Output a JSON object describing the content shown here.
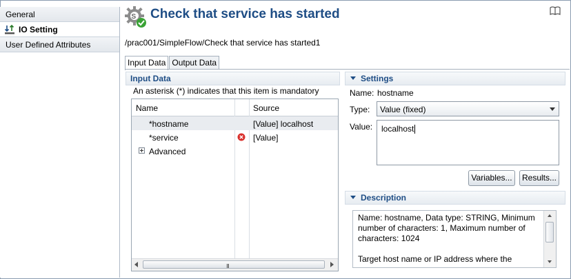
{
  "nav": {
    "items": [
      {
        "label": "General"
      },
      {
        "label": "IO Setting"
      },
      {
        "label": "User Defined Attributes"
      }
    ]
  },
  "header": {
    "title": "Check that service has started",
    "path": "/prac001/SimpleFlow/Check that service has started1"
  },
  "tabs": [
    {
      "label": "Input Data"
    },
    {
      "label": "Output Data"
    }
  ],
  "input_data": {
    "section_title": "Input Data",
    "note": "An asterisk (*) indicates that this item is mandatory",
    "columns": {
      "name": "Name",
      "source": "Source"
    },
    "rows": [
      {
        "name": "*hostname",
        "source": "[Value] localhost",
        "selected": true,
        "error": false
      },
      {
        "name": "*service",
        "source": "[Value]",
        "selected": false,
        "error": true
      },
      {
        "name": "Advanced",
        "source": "",
        "expandable": true
      }
    ],
    "scroll_grip": "III"
  },
  "settings": {
    "section_title": "Settings",
    "name_label": "Name:",
    "name_value": "hostname",
    "type_label": "Type:",
    "type_value": "Value (fixed)",
    "value_label": "Value:",
    "value_value": "localhost",
    "variables_button": "Variables...",
    "results_button": "Results..."
  },
  "description": {
    "section_title": "Description",
    "line1": "Name: hostname, Data type: STRING, Minimum number of characters: 1, Maximum number of characters: 1024",
    "line2": "Target host name or IP address where the"
  },
  "colors": {
    "title": "#1e4d85",
    "error": "#d9302c",
    "badge": "#3aa335"
  }
}
